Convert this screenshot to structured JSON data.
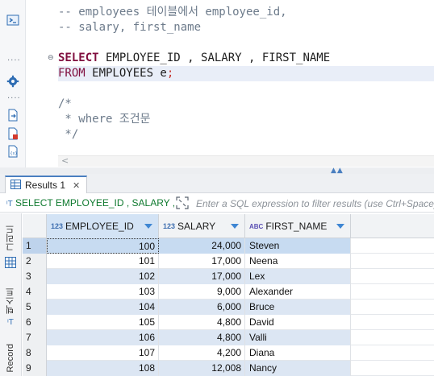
{
  "editor": {
    "lines": [
      {
        "kind": "comment",
        "text": "-- employees 테이블에서 employee_id,"
      },
      {
        "kind": "comment",
        "text": "-- salary, first_name"
      },
      {
        "kind": "blank",
        "text": ""
      },
      {
        "kind": "select",
        "kw": "SELECT",
        "rest": " EMPLOYEE_ID , SALARY , FIRST_NAME"
      },
      {
        "kind": "from",
        "kw": "FROM",
        "rest": " EMPLOYEES e",
        "semi": ";"
      },
      {
        "kind": "blank",
        "text": ""
      },
      {
        "kind": "comment",
        "text": "/*"
      },
      {
        "kind": "comment",
        "text": " * where 조건문"
      },
      {
        "kind": "comment",
        "text": " */"
      }
    ],
    "fold_marker": "⊖",
    "scroll_left_arrow": "<"
  },
  "results": {
    "tab_label": "Results 1",
    "tab_close": "✕",
    "filter_query": "SELECT EMPLOYEE_ID , SALARY ,",
    "filter_placeholder": "Enter a SQL expression to filter results (use Ctrl+Space)",
    "side_tabs": [
      "그리드",
      "텍스트",
      "Record"
    ],
    "columns": [
      {
        "name": "EMPLOYEE_ID",
        "type_icon": "123"
      },
      {
        "name": "SALARY",
        "type_icon": "123"
      },
      {
        "name": "FIRST_NAME",
        "type_icon": "ABC"
      }
    ],
    "rows": [
      {
        "idx": "1",
        "id": "100",
        "salary": "24,000",
        "name": "Steven"
      },
      {
        "idx": "2",
        "id": "101",
        "salary": "17,000",
        "name": "Neena"
      },
      {
        "idx": "3",
        "id": "102",
        "salary": "17,000",
        "name": "Lex"
      },
      {
        "idx": "4",
        "id": "103",
        "salary": "9,000",
        "name": "Alexander"
      },
      {
        "idx": "5",
        "id": "104",
        "salary": "6,000",
        "name": "Bruce"
      },
      {
        "idx": "6",
        "id": "105",
        "salary": "4,800",
        "name": "David"
      },
      {
        "idx": "7",
        "id": "106",
        "salary": "4,800",
        "name": "Valli"
      },
      {
        "idx": "8",
        "id": "107",
        "salary": "4,200",
        "name": "Diana"
      },
      {
        "idx": "9",
        "id": "108",
        "salary": "12,008",
        "name": "Nancy"
      }
    ]
  },
  "colors": {
    "accent": "#4a7fc0",
    "keyword": "#7f0d3d",
    "comment": "#6d7b8b",
    "filter_text": "#0f7a2f",
    "row_alt": "#dce6f3"
  }
}
